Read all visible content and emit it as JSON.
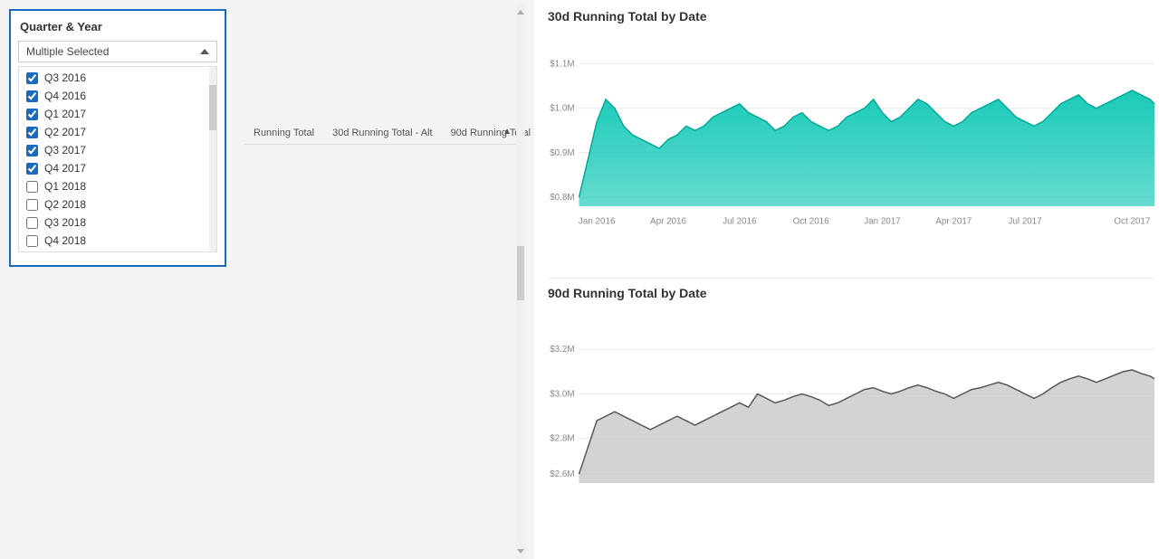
{
  "filter": {
    "title": "Quarter & Year",
    "header_label": "Multiple Selected",
    "items": [
      {
        "label": "Q3 2016",
        "checked": true
      },
      {
        "label": "Q4 2016",
        "checked": true
      },
      {
        "label": "Q1 2017",
        "checked": true
      },
      {
        "label": "Q2 2017",
        "checked": true
      },
      {
        "label": "Q3 2017",
        "checked": true
      },
      {
        "label": "Q4 2017",
        "checked": true
      },
      {
        "label": "Q1 2018",
        "checked": false
      },
      {
        "label": "Q2 2018",
        "checked": false
      },
      {
        "label": "Q3 2018",
        "checked": false
      },
      {
        "label": "Q4 2018",
        "checked": false
      }
    ]
  },
  "tabs": [
    {
      "label": "Running Total",
      "active": false
    },
    {
      "label": "30d Running Total - Alt",
      "active": false
    },
    {
      "label": "90d Running Total",
      "active": false
    }
  ],
  "chart1": {
    "title": "30d Running Total by Date",
    "y_labels": [
      "$1.1M",
      "$1.0M",
      "$0.9M",
      "$0.8M"
    ],
    "x_labels": [
      "Jan 2016",
      "Apr 2016",
      "Jul 2016",
      "Oct 2016",
      "Jan 2017",
      "Apr 2017",
      "Jul 2017",
      "Oct 2017"
    ],
    "color": "#00c4b0"
  },
  "chart2": {
    "title": "90d Running Total by Date",
    "y_labels": [
      "$3.2M",
      "$3.0M",
      "$2.8M",
      "$2.6M"
    ],
    "x_labels": [
      "Jan 2016",
      "Apr 2016",
      "Jul 2016",
      "Oct 2016",
      "Jan 2017",
      "Apr 2017",
      "Jul 2017",
      "Oct 2017"
    ],
    "color": "#888"
  }
}
